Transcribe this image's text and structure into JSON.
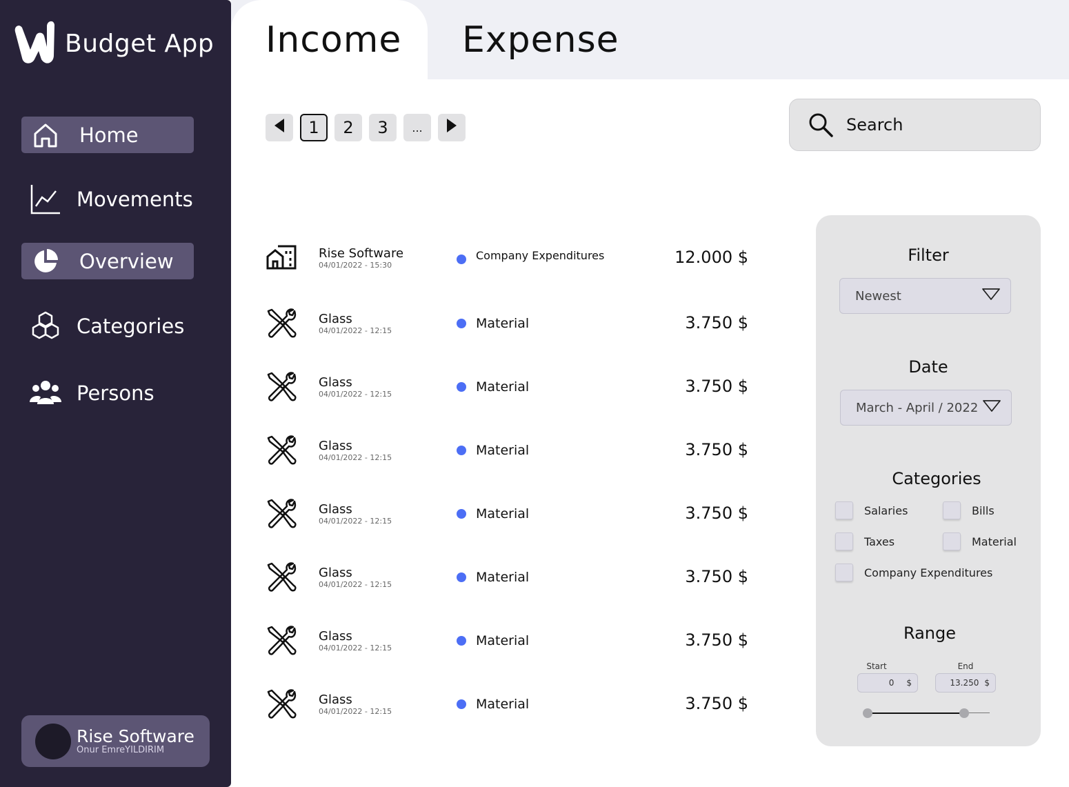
{
  "app": {
    "title": "Budget App"
  },
  "sidebar": {
    "items": [
      {
        "label": "Home",
        "icon": "home-icon",
        "active": true
      },
      {
        "label": "Movements",
        "icon": "chart-line-icon",
        "active": false
      },
      {
        "label": "Overview",
        "icon": "pie-chart-icon",
        "active": true
      },
      {
        "label": "Categories",
        "icon": "cubes-icon",
        "active": false
      },
      {
        "label": "Persons",
        "icon": "people-icon",
        "active": false
      }
    ],
    "profile": {
      "name": "Rise Software",
      "subtitle": "Onur EmreYILDIRIM"
    }
  },
  "tabs": [
    {
      "label": "Income",
      "active": true
    },
    {
      "label": "Expense",
      "active": false
    }
  ],
  "pagination": {
    "pages": [
      "1",
      "2",
      "3",
      "..."
    ],
    "current": "1"
  },
  "search": {
    "placeholder": "Search"
  },
  "transactions": [
    {
      "name": "Rise Software",
      "date": "04/01/2022 - 15:30",
      "category": "Company Expenditures",
      "amount": "12.000 $",
      "icon": "building-icon"
    },
    {
      "name": "Glass",
      "date": "04/01/2022 - 12:15",
      "category": "Material",
      "amount": "3.750 $",
      "icon": "tools-icon"
    },
    {
      "name": "Glass",
      "date": "04/01/2022 - 12:15",
      "category": "Material",
      "amount": "3.750 $",
      "icon": "tools-icon"
    },
    {
      "name": "Glass",
      "date": "04/01/2022 - 12:15",
      "category": "Material",
      "amount": "3.750 $",
      "icon": "tools-icon"
    },
    {
      "name": "Glass",
      "date": "04/01/2022 - 12:15",
      "category": "Material",
      "amount": "3.750 $",
      "icon": "tools-icon"
    },
    {
      "name": "Glass",
      "date": "04/01/2022 - 12:15",
      "category": "Material",
      "amount": "3.750 $",
      "icon": "tools-icon"
    },
    {
      "name": "Glass",
      "date": "04/01/2022 - 12:15",
      "category": "Material",
      "amount": "3.750 $",
      "icon": "tools-icon"
    },
    {
      "name": "Glass",
      "date": "04/01/2022 - 12:15",
      "category": "Material",
      "amount": "3.750 $",
      "icon": "tools-icon"
    }
  ],
  "filter_panel": {
    "filter": {
      "title": "Filter",
      "value": "Newest"
    },
    "date": {
      "title": "Date",
      "value": "March - April / 2022"
    },
    "categories": {
      "title": "Categories",
      "options": [
        {
          "label": "Salaries",
          "checked": false
        },
        {
          "label": "Bills",
          "checked": false
        },
        {
          "label": "Taxes",
          "checked": false
        },
        {
          "label": "Material",
          "checked": false
        },
        {
          "label": "Company Expenditures",
          "checked": false
        }
      ]
    },
    "range": {
      "title": "Range",
      "start_label": "Start",
      "start_value": "0",
      "end_label": "End",
      "end_value": "13.250",
      "currency": "$"
    }
  },
  "colors": {
    "sidebar_bg": "#282339",
    "sidebar_active": "#5c5574",
    "tabbar_bg": "#eff0f5",
    "panel_bg": "#e4e4e5",
    "category_dot": "#4c6ef5"
  }
}
